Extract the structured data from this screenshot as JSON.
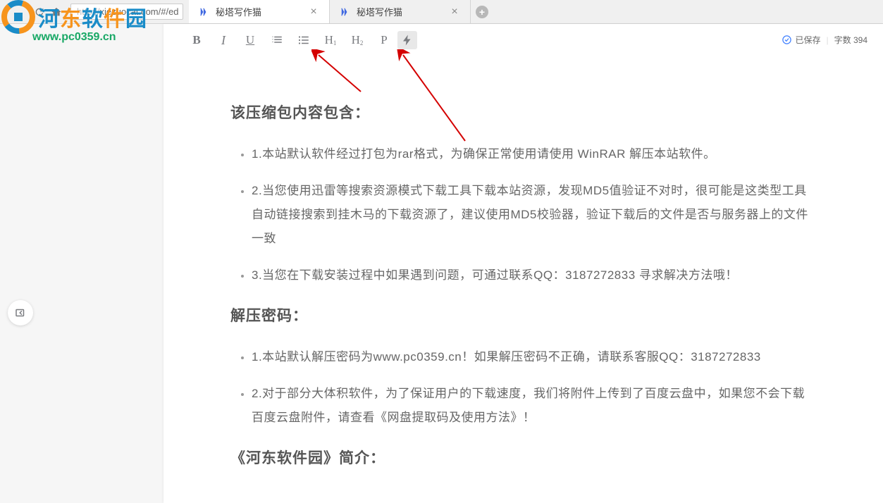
{
  "browser": {
    "url_full": "xiezuocat.com/#/ed",
    "tabs": [
      {
        "title": "秘塔写作猫",
        "active": true
      },
      {
        "title": "秘塔写作猫",
        "active": false
      }
    ]
  },
  "toolbar": {
    "bold": "B",
    "italic": "I",
    "underline": "U",
    "h1": "H",
    "h1_sub": "1",
    "h2": "H",
    "h2_sub": "2",
    "paragraph": "P"
  },
  "status": {
    "saved_label": "已保存",
    "word_count_label": "字数 394"
  },
  "document": {
    "sections": [
      {
        "heading": "该压缩包内容包含：",
        "items": [
          "1.本站默认软件经过打包为rar格式，为确保正常使用请使用 WinRAR 解压本站软件。",
          "2.当您使用迅雷等搜索资源模式下载工具下载本站资源，发现MD5值验证不对时，很可能是这类型工具自动链接搜索到挂木马的下载资源了，建议使用MD5校验器，验证下载后的文件是否与服务器上的文件一致",
          "3.当您在下载安装过程中如果遇到问题，可通过联系QQ：3187272833 寻求解决方法哦！"
        ]
      },
      {
        "heading": "解压密码：",
        "items": [
          "1.本站默认解压密码为www.pc0359.cn！如果解压密码不正确，请联系客服QQ：3187272833",
          "2.对于部分大体积软件，为了保证用户的下载速度，我们将附件上传到了百度云盘中，如果您不会下载百度云盘附件，请查看《网盘提取码及使用方法》！"
        ]
      },
      {
        "heading": "《河东软件园》简介：",
        "items": []
      }
    ]
  },
  "watermark": {
    "text": "河东软件园",
    "url": "www.pc0359.cn"
  }
}
